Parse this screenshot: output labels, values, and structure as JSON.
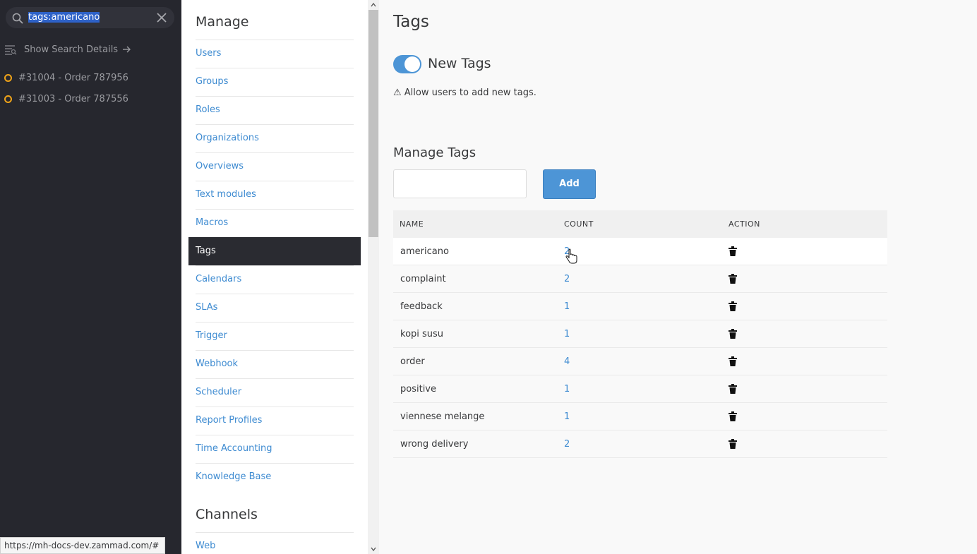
{
  "search": {
    "query": "tags:americano"
  },
  "sidebar": {
    "details_label": "Show Search Details",
    "results": [
      {
        "label": "#31004 - Order 787956"
      },
      {
        "label": "#31003 - Order 787556"
      }
    ]
  },
  "manage": {
    "title": "Manage",
    "items": [
      {
        "label": "Users"
      },
      {
        "label": "Groups"
      },
      {
        "label": "Roles"
      },
      {
        "label": "Organizations"
      },
      {
        "label": "Overviews"
      },
      {
        "label": "Text modules"
      },
      {
        "label": "Macros"
      },
      {
        "label": "Tags"
      },
      {
        "label": "Calendars"
      },
      {
        "label": "SLAs"
      },
      {
        "label": "Trigger"
      },
      {
        "label": "Webhook"
      },
      {
        "label": "Scheduler"
      },
      {
        "label": "Report Profiles"
      },
      {
        "label": "Time Accounting"
      },
      {
        "label": "Knowledge Base"
      }
    ],
    "active": "Tags"
  },
  "channels": {
    "title": "Channels",
    "items": [
      {
        "label": "Web"
      }
    ]
  },
  "main": {
    "title": "Tags",
    "toggle_label": "New Tags",
    "toggle_on": true,
    "hint": "⚠ Allow users to add new tags.",
    "manage_title": "Manage Tags",
    "add_label": "Add",
    "table": {
      "headers": [
        "NAME",
        "COUNT",
        "ACTION"
      ],
      "rows": [
        {
          "name": "americano",
          "count": "2"
        },
        {
          "name": "complaint",
          "count": "2"
        },
        {
          "name": "feedback",
          "count": "1"
        },
        {
          "name": "kopi susu",
          "count": "1"
        },
        {
          "name": "order",
          "count": "4"
        },
        {
          "name": "positive",
          "count": "1"
        },
        {
          "name": "viennese melange",
          "count": "1"
        },
        {
          "name": "wrong delivery",
          "count": "2"
        }
      ]
    }
  },
  "status_url": "https://mh-docs-dev.zammad.com/#",
  "colors": {
    "accent": "#4d95d6",
    "link": "#3e8bd1",
    "sidebar": "#26272e",
    "result_dot": "#f0a419"
  }
}
